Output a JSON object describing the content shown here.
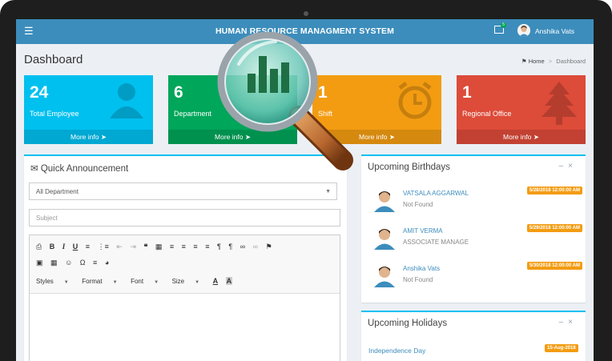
{
  "app": {
    "title": "HUMAN RESOURCE MANAGMENT SYSTEM",
    "user_name": "Anshika Vats",
    "mail_badge": "5"
  },
  "page": {
    "title": "Dashboard",
    "breadcrumb": {
      "home": "Home",
      "current": "Dashboard"
    }
  },
  "stats": [
    {
      "value": "24",
      "label": "Total Employee",
      "more": "More info",
      "color": "#00c0ef"
    },
    {
      "value": "6",
      "label": "Department",
      "more": "More info",
      "color": "#00a65a"
    },
    {
      "value": "1",
      "label": "Shift",
      "more": "More info",
      "color": "#f39c12"
    },
    {
      "value": "1",
      "label": "Regional Office",
      "more": "More info",
      "color": "#dd4b39"
    }
  ],
  "announcement": {
    "title": "Quick Announcement",
    "department_select": "All Department",
    "subject_placeholder": "Subject",
    "editor_combos": {
      "styles": "Styles",
      "format": "Format",
      "font": "Font",
      "size": "Size"
    }
  },
  "birthdays": {
    "title": "Upcoming Birthdays",
    "items": [
      {
        "name": "VATSALA AGGARWAL",
        "subtitle": "Not Found",
        "date": "5/28/2018 12:00:00 AM"
      },
      {
        "name": "AMIT VERMA",
        "subtitle": "ASSOCIATE MANAGE",
        "date": "5/29/2018 12:00:00 AM"
      },
      {
        "name": "Anshika Vats",
        "subtitle": "Not Found",
        "date": "5/30/2018 12:00:00 AM"
      }
    ]
  },
  "holidays": {
    "title": "Upcoming Holidays",
    "items": [
      {
        "name": "Independence Day",
        "date": "15-Aug-2018"
      }
    ]
  },
  "colors": {
    "header": "#3c8dbc",
    "panel_border": "#00c0ef",
    "date_badge": "#f39c12",
    "magnifier_handle": "#b8672e"
  }
}
